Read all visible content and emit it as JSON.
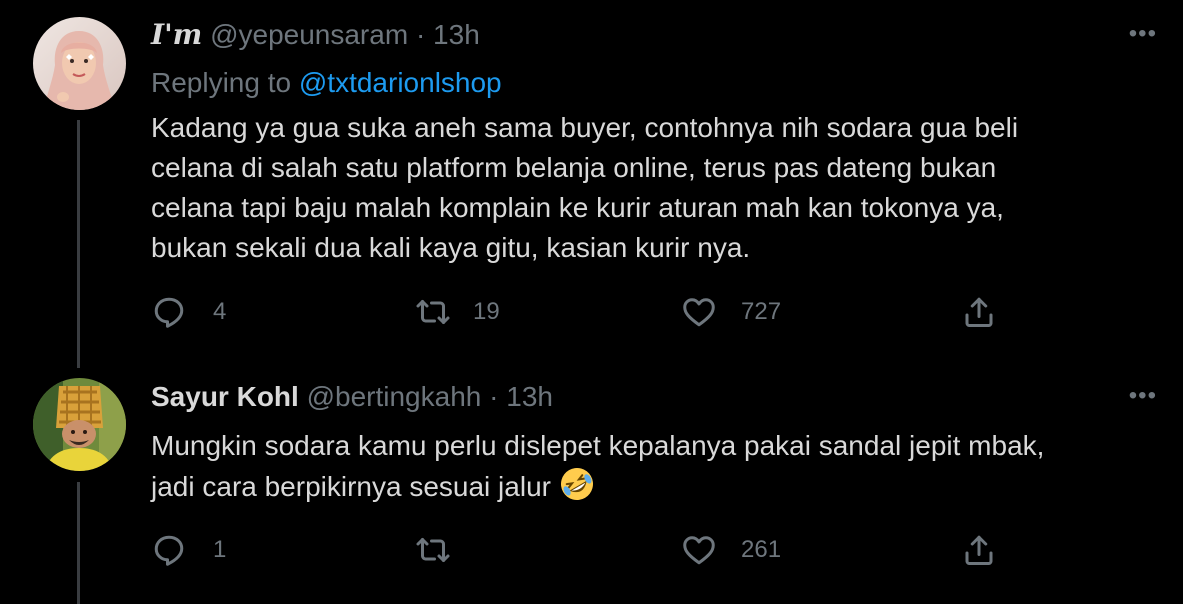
{
  "tweets": [
    {
      "display_name": "I'm",
      "handle": "@yepeunsaram",
      "separator": "·",
      "time": "13h",
      "more_label": "•••",
      "replying_prefix": "Replying to",
      "replying_to": "@txtdarionlshop",
      "lines": [
        "Kadang ya gua suka aneh sama buyer, contohnya nih sodara gua beli",
        "celana di salah satu platform belanja online, terus pas dateng bukan",
        "celana tapi baju malah komplain ke kurir aturan mah kan tokonya ya,",
        "bukan sekali dua kali kaya gitu, kasian kurir nya."
      ],
      "reply_count": "4",
      "retweet_count": "19",
      "like_count": "727",
      "share_count": ""
    },
    {
      "display_name": "Sayur Kohl",
      "handle": "@bertingkahh",
      "separator": "·",
      "time": "13h",
      "more_label": "•••",
      "lines": [
        "Mungkin sodara kamu perlu dislepet kepalanya pakai sandal jepit mbak,",
        "jadi cara berpikirnya sesuai jalur"
      ],
      "emoji": "rolling-on-floor-laughing",
      "reply_count": "1",
      "retweet_count": "",
      "like_count": "261",
      "share_count": ""
    }
  ],
  "icons": {
    "reply": "reply-icon",
    "retweet": "retweet-icon",
    "like": "like-icon",
    "share": "share-icon",
    "more": "more-icon"
  },
  "colors": {
    "background": "#000000",
    "text": "#d9d9d9",
    "secondary": "#6e767d",
    "link": "#1d9bf0",
    "thread_line": "#3a3d41"
  }
}
